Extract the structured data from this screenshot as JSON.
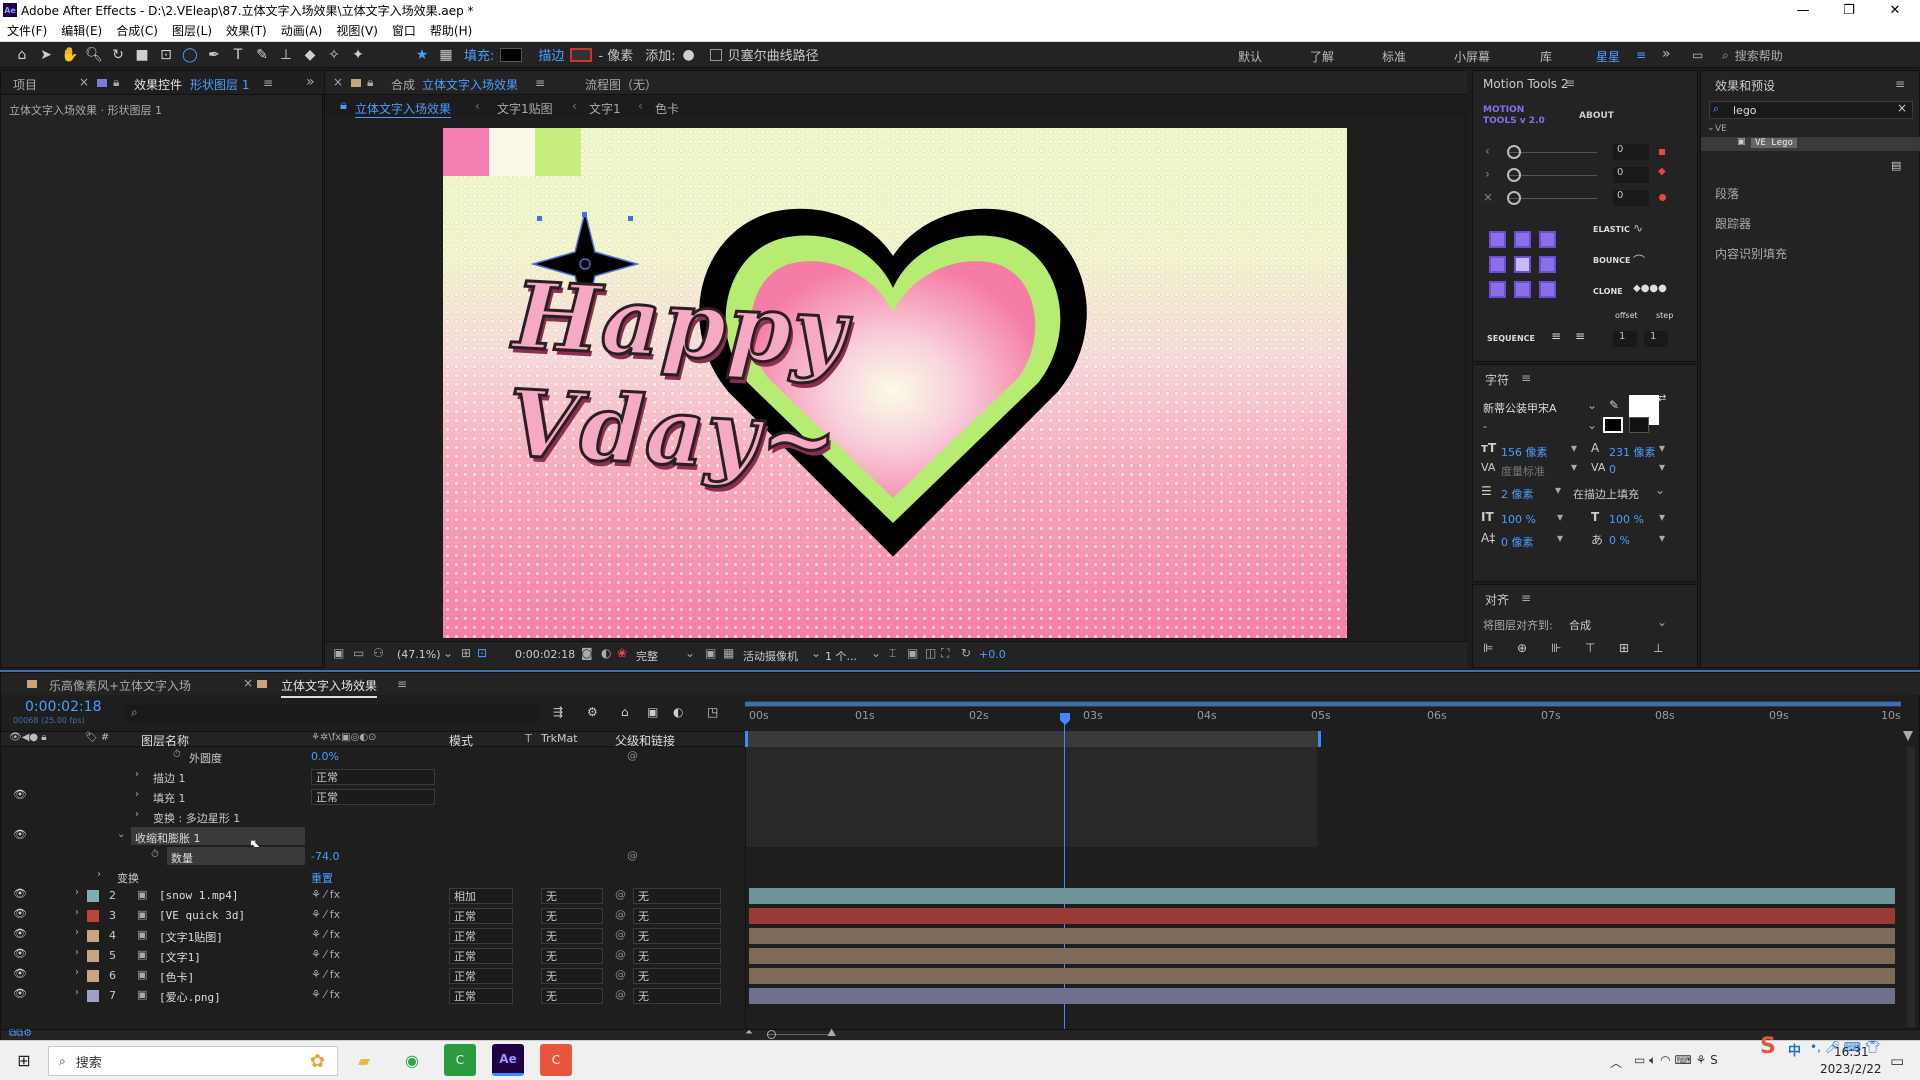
{
  "app": {
    "title": "Adobe After Effects - D:\\2.VEleap\\87.立体文字入场效果\\立体文字入场效果.aep *",
    "logo": "Ae"
  },
  "menu": [
    "文件(F)",
    "编辑(E)",
    "合成(C)",
    "图层(L)",
    "效果(T)",
    "动画(A)",
    "视图(V)",
    "窗口",
    "帮助(H)"
  ],
  "toolbar": {
    "fill_label": "填充:",
    "stroke_label": "描边",
    "stroke_unit": "- 像素",
    "add_label": "添加:",
    "bezier_label": "贝塞尔曲线路径"
  },
  "workspaces": [
    "默认",
    "了解",
    "标准",
    "小屏幕",
    "库",
    "星星"
  ],
  "search_help": "搜索帮助",
  "left_panel": {
    "tab_project": "项目",
    "tab_effects": "效果控件",
    "tab_effects_target": "形状图层 1",
    "breadcrumb": "立体文字入场效果 · 形状图层 1"
  },
  "comp_panel": {
    "tab_prefix": "合成",
    "tab_name": "立体文字入场效果",
    "flow_tab": "流程图（无）",
    "crumbs": [
      "立体文字入场效果",
      "文字1贴图",
      "文字1",
      "色卡"
    ],
    "zoom": "(47.1%)",
    "timecode": "0:00:02:18",
    "quality": "完整",
    "camera": "活动摄像机",
    "views": "1 个...",
    "exposure": "+0.0",
    "canvas_text": "Happy Vday~"
  },
  "motion_tools": {
    "title": "Motion Tools 2",
    "logo_line1": "MOTION",
    "logo_line2": "TOOLS v 2.0",
    "about": "ABOUT",
    "slider_values": [
      "0",
      "0",
      "0"
    ],
    "elastic": "ELASTIC",
    "bounce": "BOUNCE",
    "clone": "CLONE",
    "offset": "offset",
    "step": "step",
    "sequence": "SEQUENCE",
    "seq_values": [
      "1",
      "1"
    ]
  },
  "effects_presets": {
    "title": "效果和预设",
    "search_value": "lego",
    "folder": "VE",
    "item": "VE Lego",
    "sections": [
      "段落",
      "跟踪器",
      "内容识别填充"
    ]
  },
  "character": {
    "title": "字符",
    "font": "新蒂公装甲宋A",
    "style": "-",
    "size": "156 像素",
    "leading": "231 像素",
    "kerning": "度量标准",
    "tracking": "0",
    "stroke_w": "2 像素",
    "stroke_mode": "在描边上填充",
    "vscale": "100 %",
    "hscale": "100 %",
    "baseline": "0 像素",
    "tsume": "0 %"
  },
  "align": {
    "title": "对齐",
    "align_to_label": "将图层对齐到:",
    "align_to": "合成"
  },
  "timeline": {
    "tab_other": "乐高像素风+立体文字入场",
    "tab_active": "立体文字入场效果",
    "timecode": "0:00:02:18",
    "fps": "00068 (25.00 fps)",
    "col_name": "图层名称",
    "col_mode": "模式",
    "col_t": "T",
    "col_trkmat": "TrkMat",
    "col_parent": "父级和链接",
    "ruler": [
      "00s",
      "01s",
      "02s",
      "03s",
      "04s",
      "05s",
      "06s",
      "07s",
      "08s",
      "09s",
      "10s"
    ],
    "props": [
      {
        "label": "外圆度",
        "value": "0.0%"
      },
      {
        "label": "描边 1",
        "value": "正常"
      },
      {
        "label": "填充 1",
        "value": "正常"
      },
      {
        "label": "变换 : 多边星形 1",
        "value": ""
      },
      {
        "label": "收缩和膨胀 1",
        "value": ""
      },
      {
        "label": "数量",
        "value": "-74.0"
      },
      {
        "label": "变换",
        "value": "重置"
      }
    ],
    "layers": [
      {
        "num": "2",
        "name": "[snow 1.mp4]",
        "mode": "相加",
        "trk": "无",
        "parent": "无",
        "color": "#7ab0b5",
        "bar": "#6e9497"
      },
      {
        "num": "3",
        "name": "[VE quick 3d]",
        "mode": "正常",
        "trk": "无",
        "parent": "无",
        "color": "#c0433a",
        "bar": "#9a3a34"
      },
      {
        "num": "4",
        "name": "[文字1贴图]",
        "mode": "正常",
        "trk": "无",
        "parent": "无",
        "color": "#c7a580",
        "bar": "#7d6a58"
      },
      {
        "num": "5",
        "name": "[文字1]",
        "mode": "正常",
        "trk": "无",
        "parent": "无",
        "color": "#c7a580",
        "bar": "#7d6a58"
      },
      {
        "num": "6",
        "name": "[色卡]",
        "mode": "正常",
        "trk": "无",
        "parent": "无",
        "color": "#c7a580",
        "bar": "#7d6a58"
      },
      {
        "num": "7",
        "name": "[爱心.png]",
        "mode": "正常",
        "trk": "无",
        "parent": "无",
        "color": "#9fa0c8",
        "bar": "#6f6f8e"
      }
    ]
  },
  "taskbar": {
    "search": "搜索",
    "time": "16:31",
    "date": "2023/2/22",
    "ime": "中"
  },
  "colors": {
    "accent": "#4a9eff",
    "playhead": "#3b8cff"
  }
}
